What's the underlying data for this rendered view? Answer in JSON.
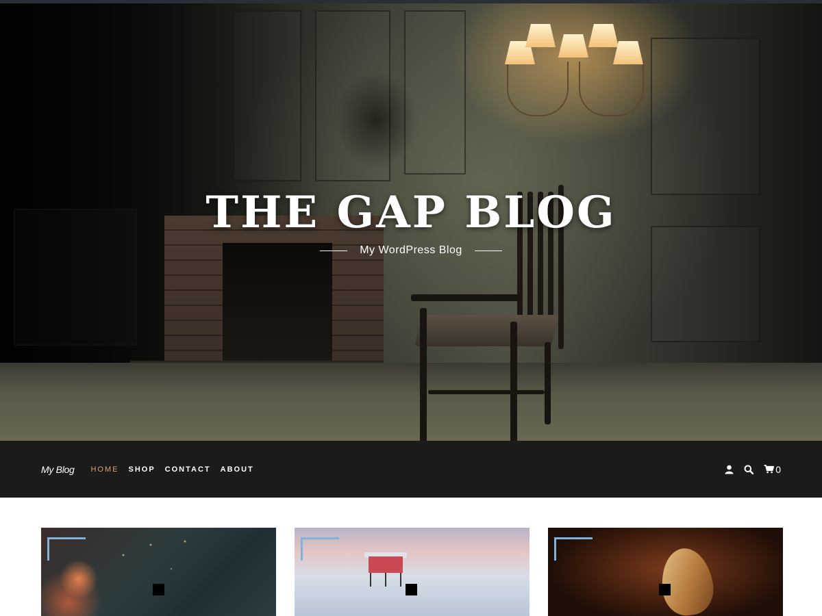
{
  "site": {
    "title": "THE GAP BLOG",
    "tagline": "My WordPress Blog"
  },
  "nav": {
    "brand": "My Blog",
    "items": [
      {
        "label": "HOME",
        "active": true
      },
      {
        "label": "SHOP",
        "active": false
      },
      {
        "label": "CONTACT",
        "active": false
      },
      {
        "label": "ABOUT",
        "active": false
      }
    ],
    "icons": [
      "user-icon",
      "search-icon",
      "cart-icon"
    ],
    "cart_count": "0"
  },
  "cards": [
    {
      "image": "bokeh-lights-thumbnail"
    },
    {
      "image": "stilt-house-sea-thumbnail"
    },
    {
      "image": "dry-leaf-thumbnail"
    }
  ],
  "colors": {
    "nav_background": "#1b1b1c",
    "nav_active": "#d9a26b",
    "card_corner_accent": "#7fb3dc"
  }
}
